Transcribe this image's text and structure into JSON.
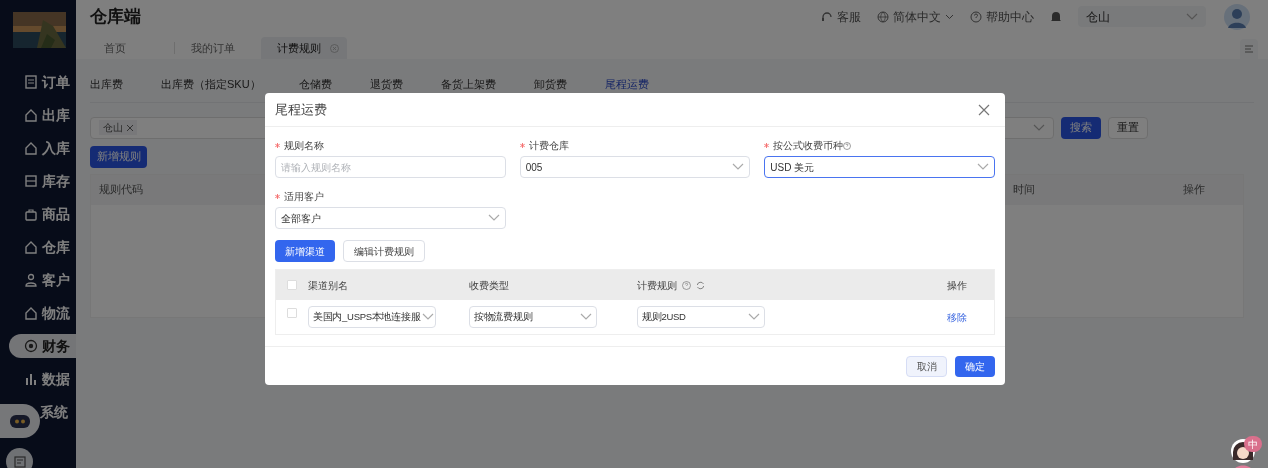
{
  "app": {
    "title": "仓库端"
  },
  "header": {
    "service": "客服",
    "language": "简体中文",
    "help": "帮助中心",
    "warehouse_select": "仓山"
  },
  "page_tabs": [
    {
      "label": "首页",
      "selected": false,
      "closable": false
    },
    {
      "label": "我的订单",
      "selected": false,
      "closable": false
    },
    {
      "label": "计费规则",
      "selected": true,
      "closable": true
    }
  ],
  "sidebar": {
    "items": [
      {
        "label": "订单",
        "selected": false
      },
      {
        "label": "出库",
        "selected": false
      },
      {
        "label": "入库",
        "selected": false
      },
      {
        "label": "库存",
        "selected": false
      },
      {
        "label": "商品",
        "selected": false
      },
      {
        "label": "仓库",
        "selected": false
      },
      {
        "label": "客户",
        "selected": false
      },
      {
        "label": "物流",
        "selected": false
      },
      {
        "label": "财务",
        "selected": true
      },
      {
        "label": "数据",
        "selected": false
      },
      {
        "label": "系统",
        "selected": false
      }
    ]
  },
  "fee_tabs": [
    {
      "label": "出库费",
      "selected": false
    },
    {
      "label": "出库费（指定SKU）",
      "selected": false
    },
    {
      "label": "仓储费",
      "selected": false
    },
    {
      "label": "退货费",
      "selected": false
    },
    {
      "label": "备货上架费",
      "selected": false
    },
    {
      "label": "卸货费",
      "selected": false
    },
    {
      "label": "尾程运费",
      "selected": true
    }
  ],
  "filter": {
    "tag": "仓山",
    "search_button": "搜索",
    "reset_button": "重置"
  },
  "add_rule_button": "新增规则",
  "rules_table": {
    "columns": [
      "规则代码",
      "时间",
      "操作"
    ]
  },
  "dialog": {
    "title": "尾程运费",
    "fields": [
      {
        "label": "规则名称",
        "required": true,
        "kind": "input",
        "placeholder": "请输入规则名称",
        "focused": false
      },
      {
        "label": "计费仓库",
        "required": true,
        "kind": "select",
        "value": "005",
        "focused": false
      },
      {
        "label": "按公式收费币种",
        "required": true,
        "kind": "select",
        "value": "USD 美元",
        "focused": true,
        "help": true
      },
      {
        "label": "适用客户",
        "required": true,
        "kind": "select",
        "value": "全部客户",
        "focused": false
      }
    ],
    "add_channel_button": "新增渠道",
    "edit_rules_button": "编辑计费规则",
    "table": {
      "all_checked": false,
      "columns": [
        "渠道别名",
        "收费类型",
        "计费规则",
        "操作"
      ],
      "rows": [
        {
          "checked": false,
          "channel": "美国内_USPS本地连接服",
          "charge_type": "按物流费规则",
          "rule": "规则2USD",
          "action": "移除"
        }
      ]
    },
    "cancel_button": "取消",
    "ok_button": "确定"
  },
  "ime_badge": "中"
}
